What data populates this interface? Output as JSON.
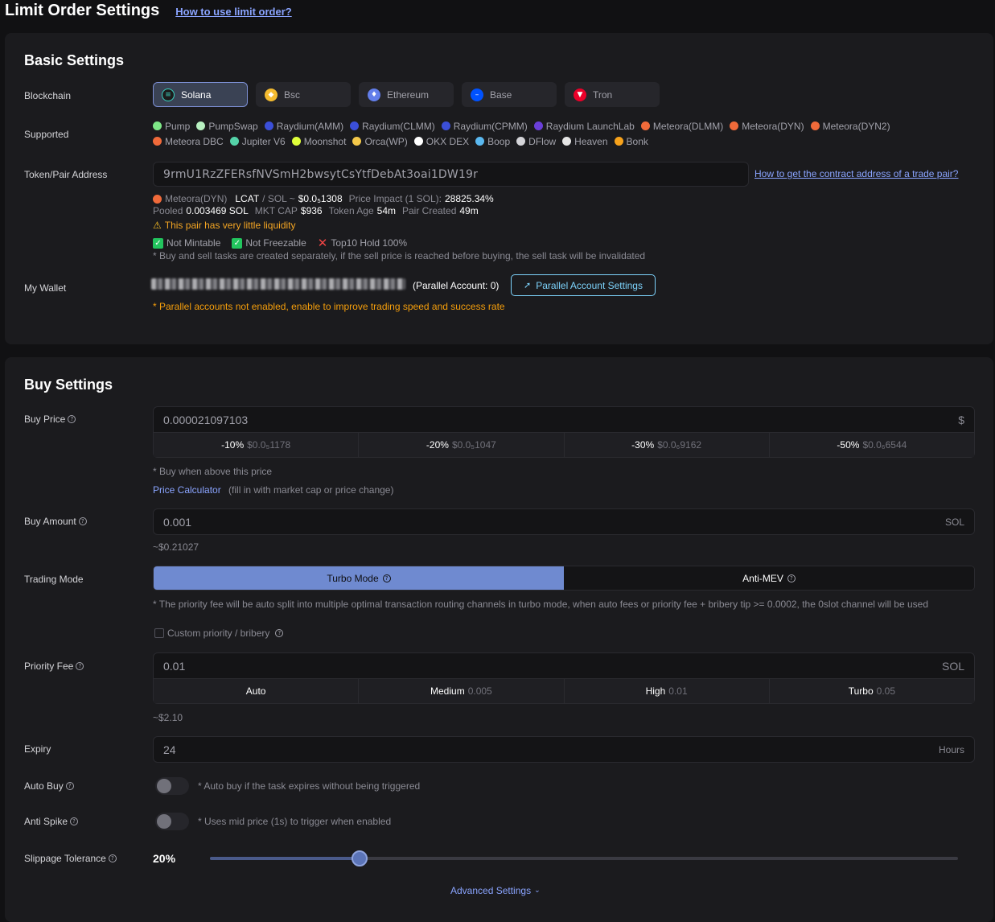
{
  "header": {
    "title": "Limit Order Settings",
    "help_link": "How to use limit order?"
  },
  "basic": {
    "title": "Basic Settings",
    "labels": {
      "blockchain": "Blockchain",
      "supported": "Supported",
      "address": "Token/Pair Address",
      "wallet": "My Wallet"
    },
    "chains": [
      {
        "label": "Solana",
        "color": "#1c1c1c",
        "icon": "solana-icon",
        "glyph": "≡",
        "active": true
      },
      {
        "label": "Bsc",
        "color": "#f3ba2f",
        "icon": "bsc-icon",
        "glyph": "◆"
      },
      {
        "label": "Ethereum",
        "color": "#627eea",
        "icon": "ethereum-icon",
        "glyph": "♦"
      },
      {
        "label": "Base",
        "color": "#0052ff",
        "icon": "base-icon",
        "glyph": "–"
      },
      {
        "label": "Tron",
        "color": "#eb0029",
        "icon": "tron-icon",
        "glyph": "▼"
      }
    ],
    "dexes": [
      {
        "label": "Pump",
        "color": "#7ee787"
      },
      {
        "label": "PumpSwap",
        "color": "#b7f0c0"
      },
      {
        "label": "Raydium(AMM)",
        "color": "#3b4fd8"
      },
      {
        "label": "Raydium(CLMM)",
        "color": "#3b4fd8"
      },
      {
        "label": "Raydium(CPMM)",
        "color": "#3b4fd8"
      },
      {
        "label": "Raydium LaunchLab",
        "color": "#6a3fd8"
      },
      {
        "label": "Meteora(DLMM)",
        "color": "#f06a3a"
      },
      {
        "label": "Meteora(DYN)",
        "color": "#f06a3a"
      },
      {
        "label": "Meteora(DYN2)",
        "color": "#f06a3a"
      },
      {
        "label": "Meteora DBC",
        "color": "#f06a3a"
      },
      {
        "label": "Jupiter V6",
        "color": "#54d2a8"
      },
      {
        "label": "Moonshot",
        "color": "#dfff3a"
      },
      {
        "label": "Orca(WP)",
        "color": "#f3c84a"
      },
      {
        "label": "OKX DEX",
        "color": "#ffffff"
      },
      {
        "label": "Boop",
        "color": "#5ab8f0"
      },
      {
        "label": "DFlow",
        "color": "#d4d4d8"
      },
      {
        "label": "Heaven",
        "color": "#e5e5e5"
      },
      {
        "label": "Bonk",
        "color": "#f7a21b"
      }
    ],
    "address_value": "9rmU1RzZFERsfNVSmH2bwsytCsYtfDebAt3oai1DW19r",
    "address_help": "How to get the contract address of a trade pair?",
    "pair": {
      "dex": "Meteora(DYN)",
      "token": "LCAT",
      "slash_sol": "/ SOL ~",
      "price": "$0.0₅1308",
      "impact_label": "Price Impact (1 SOL):",
      "impact_value": "28825.34%",
      "pooled_label": "Pooled",
      "pooled_value": "0.003469 SOL",
      "mktcap_label": "MKT CAP",
      "mktcap_value": "$936",
      "age_label": "Token Age",
      "age_value": "54m",
      "created_label": "Pair Created",
      "created_value": "49m"
    },
    "liquidity_warning": "This pair has very little liquidity",
    "checks": {
      "mintable": "Not Mintable",
      "freezable": "Not Freezable",
      "top10": "Top10 Hold 100%"
    },
    "tasks_note": "* Buy and sell tasks are created separately, if the sell price is reached before buying, the sell task will be invalidated",
    "parallel_account": "(Parallel Account: 0)",
    "parallel_button": "Parallel Account Settings",
    "parallel_note": "* Parallel accounts not enabled, enable to improve trading speed and success rate"
  },
  "buy": {
    "title": "Buy Settings",
    "labels": {
      "price": "Buy Price",
      "amount": "Buy Amount",
      "mode": "Trading Mode",
      "priority": "Priority Fee",
      "expiry": "Expiry",
      "auto_buy": "Auto Buy",
      "anti_spike": "Anti Spike",
      "slippage": "Slippage Tolerance"
    },
    "price_value": "0.000021097103",
    "price_unit": "$",
    "price_presets": [
      {
        "pct": "-10%",
        "value": "$0.0₅1178"
      },
      {
        "pct": "-20%",
        "value": "$0.0₅1047"
      },
      {
        "pct": "-30%",
        "value": "$0.0₆9162"
      },
      {
        "pct": "-50%",
        "value": "$0.0₆6544"
      }
    ],
    "price_note": "* Buy when above this price",
    "calc_link": "Price Calculator",
    "calc_hint": "(fill in with market cap or price change)",
    "amount_value": "0.001",
    "amount_unit": "SOL",
    "amount_usd": "~$0.21027",
    "modes": [
      {
        "label": "Turbo Mode",
        "active": true
      },
      {
        "label": "Anti-MEV",
        "active": false
      }
    ],
    "mode_note": "* The priority fee will be auto split into multiple optimal transaction routing channels in turbo mode, when auto fees or priority fee + bribery tip >= 0.0002, the 0slot channel will be used",
    "custom_priority": "Custom priority / bribery",
    "priority_value": "0.01",
    "priority_unit": "SOL",
    "priority_presets": [
      {
        "label": "Auto",
        "value": ""
      },
      {
        "label": "Medium",
        "value": "0.005"
      },
      {
        "label": "High",
        "value": "0.01"
      },
      {
        "label": "Turbo",
        "value": "0.05"
      }
    ],
    "priority_usd": "~$2.10",
    "expiry_value": "24",
    "expiry_unit": "Hours",
    "auto_buy_note": "* Auto buy if the task expires without being triggered",
    "anti_spike_note": "* Uses mid price (1s) to trigger when enabled",
    "slippage_value": "20%",
    "slippage_fraction": 0.2,
    "advanced": "Advanced Settings"
  }
}
